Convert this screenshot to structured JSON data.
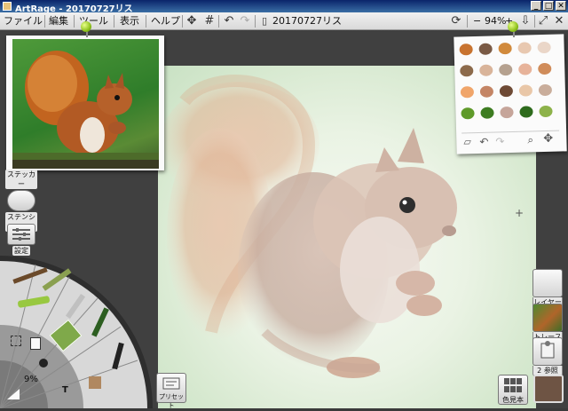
{
  "window": {
    "title": "ArtRage - 20170727リス",
    "min_label": "_",
    "max_label": "□",
    "close_label": "✕"
  },
  "menu": {
    "file": "ファイル",
    "edit": "編集",
    "tools": "ツール",
    "view": "表示",
    "help": "ヘルプ"
  },
  "toolbar": {
    "document_name": "20170727リス",
    "zoom": "94%",
    "zoom_minus": "−",
    "zoom_plus": "+"
  },
  "left_panel": {
    "stickers_label": "ステッカー",
    "stencils_label": "ステンシル",
    "settings_label": "設定"
  },
  "tool_wheel": {
    "percent": "9%",
    "text_tool_glyph": "T"
  },
  "right_panel": {
    "layers_label": "レイヤー",
    "trace_label": "トレース",
    "reference_label": "参照",
    "reference_count": "2"
  },
  "bottom": {
    "presets_label": "プリセット",
    "samples_label": "色見本"
  },
  "colors": {
    "current": "#6e5444",
    "palette_swatches": [
      "#c8732f",
      "#7a5a45",
      "#d18a3c",
      "#e8c8b0",
      "#ead6c8",
      "#8c6a4b",
      "#d9b49a",
      "#b5a18f",
      "#e7b39a",
      "#d08c5a",
      "#f0a56a",
      "#c48565",
      "#6e4a35",
      "#e9c7a8",
      "#c9ad9b",
      "#5f9a2a",
      "#3d7c21",
      "#c6a59a",
      "#2e6b1d",
      "#8db24a"
    ]
  }
}
